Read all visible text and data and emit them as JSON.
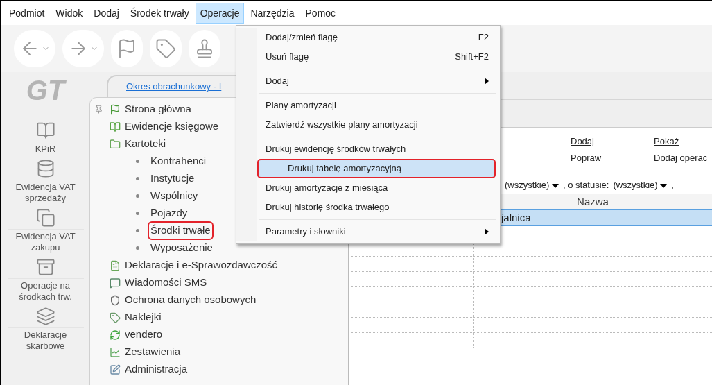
{
  "menu_bar": [
    {
      "label": "Podmiot",
      "selected": false
    },
    {
      "label": "Widok",
      "selected": false
    },
    {
      "label": "Dodaj",
      "selected": false
    },
    {
      "label": "Środek trwały",
      "selected": false
    },
    {
      "label": "Operacje",
      "selected": true
    },
    {
      "label": "Narzędzia",
      "selected": false
    },
    {
      "label": "Pomoc",
      "selected": false
    }
  ],
  "toolbar": [
    {
      "kind": "arrow-left",
      "dropdown": true
    },
    {
      "kind": "arrow-right",
      "dropdown": true
    },
    {
      "kind": "flag",
      "dropdown": false
    },
    {
      "kind": "tag",
      "dropdown": false
    },
    {
      "kind": "stamp",
      "dropdown": false
    }
  ],
  "logo_text": "GT",
  "sidebar": [
    {
      "label": "KPiR",
      "kind": "book"
    },
    {
      "label": "Ewidencja VAT sprzedaży",
      "kind": "coins"
    },
    {
      "label": "Ewidencja VAT zakupu",
      "kind": "copies"
    },
    {
      "label": "Operacje na środkach trw.",
      "kind": "cabinet"
    },
    {
      "label": "Deklaracje skarbowe",
      "kind": "stack"
    }
  ],
  "period_tab": "Okres obrachunkowy - I",
  "tree": [
    {
      "label": "Strona główna",
      "kind": "flag"
    },
    {
      "label": "Ewidencje księgowe",
      "kind": "book"
    },
    {
      "label": "Kartoteki",
      "kind": "folder",
      "children": [
        {
          "label": "Kontrahenci",
          "highlighted": false
        },
        {
          "label": "Instytucje",
          "highlighted": false
        },
        {
          "label": "Wspólnicy",
          "highlighted": false
        },
        {
          "label": "Pojazdy",
          "highlighted": false
        },
        {
          "label": "Środki trwałe",
          "highlighted": true
        },
        {
          "label": "Wyposażenie",
          "highlighted": false
        }
      ]
    },
    {
      "label": "Deklaracje i e-Sprawozdawczość",
      "kind": "form"
    },
    {
      "label": "Wiadomości SMS",
      "kind": "sms"
    },
    {
      "label": "Ochrona danych osobowych",
      "kind": "shield"
    },
    {
      "label": "Naklejki",
      "kind": "tag"
    },
    {
      "label": "vendero",
      "kind": "cycle"
    },
    {
      "label": "Zestawienia",
      "kind": "chart"
    },
    {
      "label": "Administracja",
      "kind": "edit"
    }
  ],
  "actions": [
    "Dodaj",
    "Pokaż",
    "Popraw",
    "Dodaj operac"
  ],
  "filter": [
    {
      "kind": "dropdown",
      "text": "(wszystkie)"
    },
    {
      "kind": "text",
      "text": ", o statusie:"
    },
    {
      "kind": "dropdown",
      "text": "(wszystkie)"
    },
    {
      "kind": "text",
      "text": ","
    }
  ],
  "table": {
    "columns": [
      "Nazwa"
    ],
    "rows": [
      {
        "name": "jalnica",
        "selected": true
      }
    ]
  },
  "dropdown_menu": [
    {
      "kind": "item",
      "label": "Dodaj/zmień flagę",
      "shortcut": "F2",
      "submenu": false,
      "highlighted": false
    },
    {
      "kind": "item",
      "label": "Usuń flagę",
      "shortcut": "Shift+F2",
      "submenu": false,
      "highlighted": false
    },
    {
      "kind": "separator"
    },
    {
      "kind": "item",
      "label": "Dodaj",
      "submenu": true,
      "highlighted": false
    },
    {
      "kind": "separator"
    },
    {
      "kind": "item",
      "label": "Plany amortyzacji",
      "submenu": false,
      "highlighted": false
    },
    {
      "kind": "item",
      "label": "Zatwierdź wszystkie plany amortyzacji",
      "submenu": false,
      "highlighted": false
    },
    {
      "kind": "separator"
    },
    {
      "kind": "item",
      "label": "Drukuj ewidencję środków trwałych",
      "submenu": false,
      "highlighted": false
    },
    {
      "kind": "item",
      "label": "Drukuj tabelę amortyzacyjną",
      "submenu": false,
      "highlighted": true
    },
    {
      "kind": "item",
      "label": "Drukuj amortyzacje z miesiąca",
      "submenu": false,
      "highlighted": false
    },
    {
      "kind": "item",
      "label": "Drukuj historię środka trwałego",
      "submenu": false,
      "highlighted": false
    },
    {
      "kind": "separator"
    },
    {
      "kind": "item",
      "label": "Parametry i słowniki",
      "submenu": true,
      "highlighted": false
    }
  ]
}
